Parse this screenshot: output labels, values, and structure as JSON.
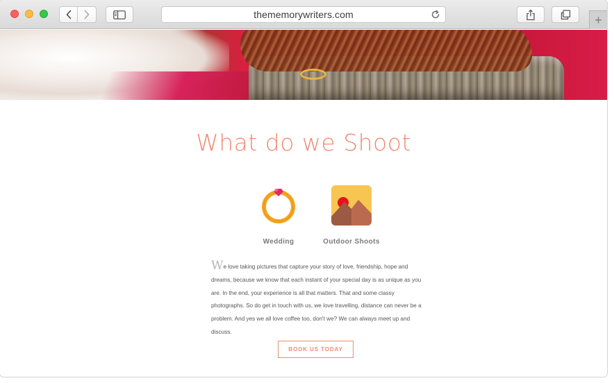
{
  "browser": {
    "url": "thememorywriters.com",
    "icons": {
      "back": "chevron-left-icon",
      "forward": "chevron-right-icon",
      "sidebar": "sidebar-icon",
      "reload": "reload-icon",
      "share": "share-icon",
      "tabs": "tabs-overview-icon",
      "new_tab": "plus-icon"
    },
    "new_tab_glyph": "+"
  },
  "page": {
    "heading": "What do we Shoot",
    "services": [
      {
        "label": "Wedding",
        "icon": "wedding-ring-icon"
      },
      {
        "label": "Outdoor Shoots",
        "icon": "landscape-photo-icon"
      }
    ],
    "body_drop_cap": "W",
    "body_text": "e love taking pictures that capture your story of love, friendship, hope and dreams, because we know that each instant of your special day is as unique as you are. In the end, your experience is all that matters. That and some classy photographs. So do get in touch with us, we love travelling, distance can never be a problem. And yes we all love coffee too, don't we? We can always meet up and discuss.",
    "cta_label": "BOOK US TODAY"
  },
  "colors": {
    "accent": "#f08a72",
    "text": "#555555",
    "label": "#7a7a7a",
    "ring_gold": "#f5a623",
    "ring_gem": "#e8236e"
  }
}
